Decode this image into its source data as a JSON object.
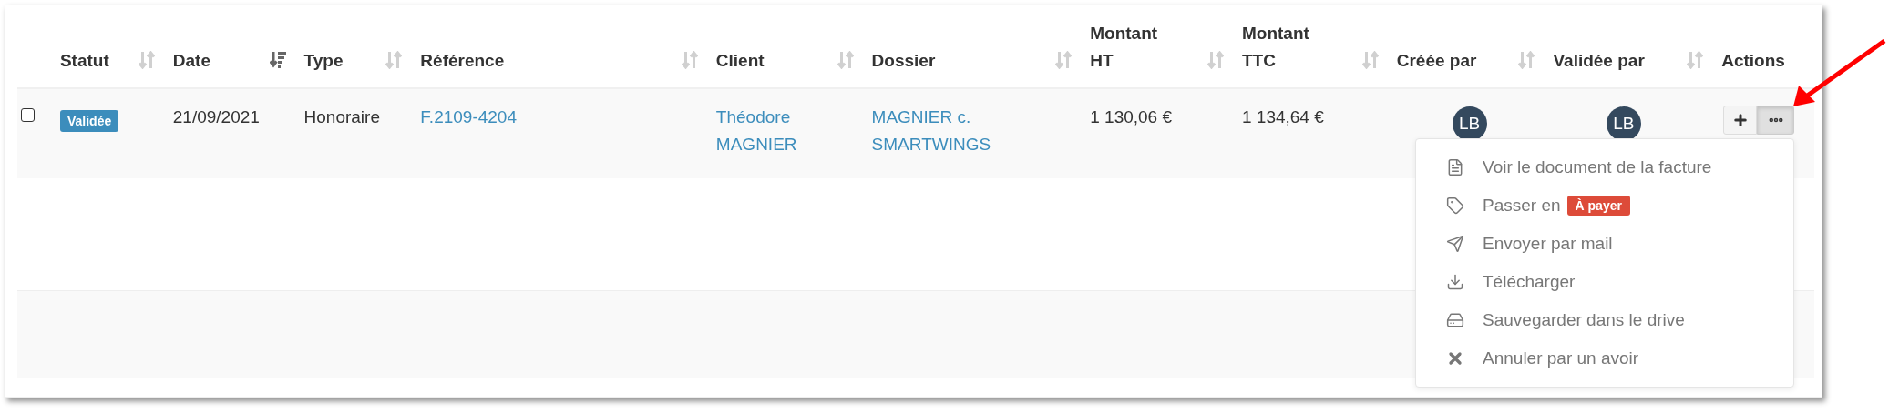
{
  "table": {
    "columns": [
      {
        "label": "Statut",
        "sorted": false
      },
      {
        "label": "Date",
        "sorted": true
      },
      {
        "label": "Type",
        "sorted": false
      },
      {
        "label": "Référence",
        "sorted": false
      },
      {
        "label": "Client",
        "sorted": false
      },
      {
        "label": "Dossier",
        "sorted": false
      },
      {
        "label": "Montant HT",
        "sorted": false
      },
      {
        "label": "Montant TTC",
        "sorted": false
      },
      {
        "label": "Créée par",
        "sorted": false
      },
      {
        "label": "Validée par",
        "sorted": false
      },
      {
        "label": "Actions"
      }
    ],
    "rows": [
      {
        "checked": false,
        "status": "Validée",
        "date": "21/09/2021",
        "type": "Honoraire",
        "reference": "F.2109-4204",
        "client": "Théodore MAGNIER",
        "dossier": "MAGNIER c. SMARTWINGS",
        "montant_ht": "1 130,06 €",
        "montant_ttc": "1 134,64 €",
        "created_by": "LB",
        "validated_by": "LB",
        "menu_open": true
      }
    ]
  },
  "actions_menu": [
    {
      "label": "Voir le document de la facture"
    },
    {
      "label": "Passer en",
      "badge": "À payer"
    },
    {
      "label": "Envoyer par mail"
    },
    {
      "label": "Télécharger"
    },
    {
      "label": "Sauvegarder dans le drive"
    },
    {
      "label": "Annuler par un avoir"
    }
  ]
}
